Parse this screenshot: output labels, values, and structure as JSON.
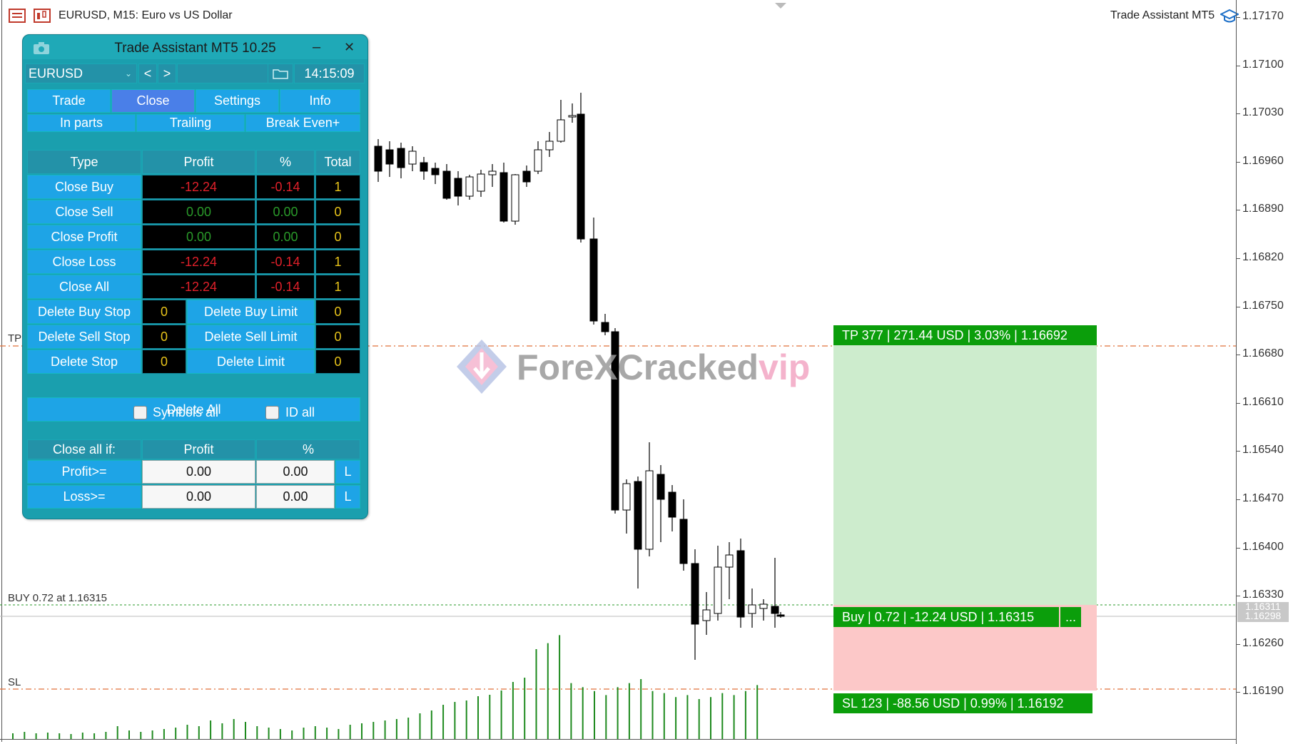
{
  "header": {
    "symbol_title": "EURUSD, M15:  Euro vs US Dollar",
    "ea_name": "Trade Assistant MT5"
  },
  "price_axis": [
    "1.17170",
    "1.17100",
    "1.17030",
    "1.16960",
    "1.16890",
    "1.16820",
    "1.16750",
    "1.16680",
    "1.16610",
    "1.16540",
    "1.16470",
    "1.16400",
    "1.16330",
    "1.16260",
    "1.16190"
  ],
  "current_price_labels": [
    "1.16311",
    "1.16298"
  ],
  "chart_labels": {
    "tp": "TP",
    "sl": "SL",
    "buy_line": "BUY 0.72 at 1.16315"
  },
  "watermark": {
    "part1": "ForeXCracked",
    "part2": "vip"
  },
  "overlay": {
    "tp_label": "TP 377 | 271.44 USD | 3.03% | 1.16692",
    "buy_label": "Buy | 0.72 | -12.24 USD | 1.16315",
    "more": "...",
    "sl_label": "SL 123 | -88.56 USD | 0.99% | 1.16192",
    "tp_color": "#cdeccd",
    "sl_color": "#fcc8c8",
    "label_color": "#0b9e0b"
  },
  "panel": {
    "title": "Trade Assistant MT5 10.25",
    "minimize": "–",
    "close": "✕",
    "symbol": "EURUSD",
    "prev": "<",
    "next": ">",
    "time": "14:15:09",
    "tabs": [
      "Trade",
      "Close",
      "Settings",
      "Info"
    ],
    "active_tab": "Close",
    "subtabs": [
      "In parts",
      "Trailing",
      "Break Even+"
    ],
    "table_headers": [
      "Type",
      "Profit",
      "%",
      "Total"
    ],
    "rows": [
      {
        "label": "Close Buy",
        "profit": "-12.24",
        "pct": "-0.14",
        "total": "1",
        "color": "red"
      },
      {
        "label": "Close Sell",
        "profit": "0.00",
        "pct": "0.00",
        "total": "0",
        "color": "green"
      },
      {
        "label": "Close Profit",
        "profit": "0.00",
        "pct": "0.00",
        "total": "0",
        "color": "green"
      },
      {
        "label": "Close Loss",
        "profit": "-12.24",
        "pct": "-0.14",
        "total": "1",
        "color": "red"
      },
      {
        "label": "Close All",
        "profit": "-12.24",
        "pct": "-0.14",
        "total": "1",
        "color": "red"
      }
    ],
    "delete_rows": [
      {
        "left": "Delete Buy Stop",
        "left_count": "0",
        "right": "Delete Buy Limit",
        "right_count": "0"
      },
      {
        "left": "Delete Sell Stop",
        "left_count": "0",
        "right": "Delete Sell Limit",
        "right_count": "0"
      },
      {
        "left": "Delete Stop",
        "left_count": "0",
        "right": "Delete Limit",
        "right_count": "0"
      }
    ],
    "delete_all": "Delete All",
    "symbols_all": "Symbols all",
    "id_all": "ID all",
    "close_if_headers": [
      "Close all if:",
      "Profit",
      "%"
    ],
    "close_if_rows": [
      {
        "label": "Profit>=",
        "profit": "0.00",
        "pct": "0.00",
        "l": "L"
      },
      {
        "label": "Loss>=",
        "profit": "0.00",
        "pct": "0.00",
        "l": "L"
      }
    ]
  }
}
